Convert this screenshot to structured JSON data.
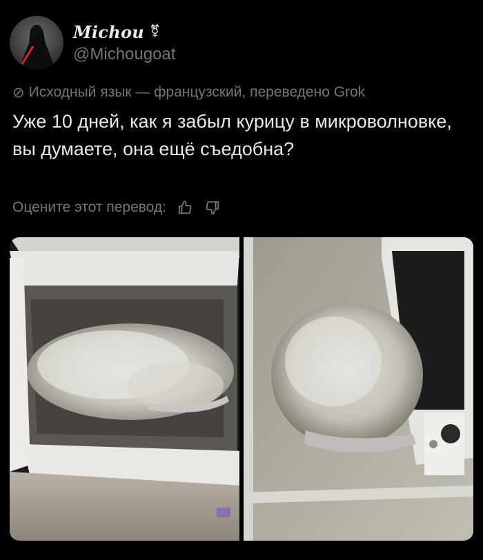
{
  "author": {
    "display_name": "Michou",
    "display_name_symbol": "⚧",
    "handle": "@Michougoat",
    "avatar": "avatar-dark-figure-red-sword"
  },
  "translation": {
    "icon": "no-entry-icon",
    "notice": "Исходный язык — французский, переведено Grok",
    "rate_label": "Оцените этот перевод:"
  },
  "tweet": {
    "text": "Уже 10 дней, как я забыл курицу в микроволновке, вы думаете, она ещё съедобна?"
  },
  "media": [
    {
      "name": "photo-microwave-open-mold",
      "icon": "image"
    },
    {
      "name": "photo-mold-tray-counter",
      "icon": "image"
    }
  ],
  "colors": {
    "background": "#000000",
    "text_primary": "#e7e9ea",
    "text_secondary": "#71767b"
  }
}
